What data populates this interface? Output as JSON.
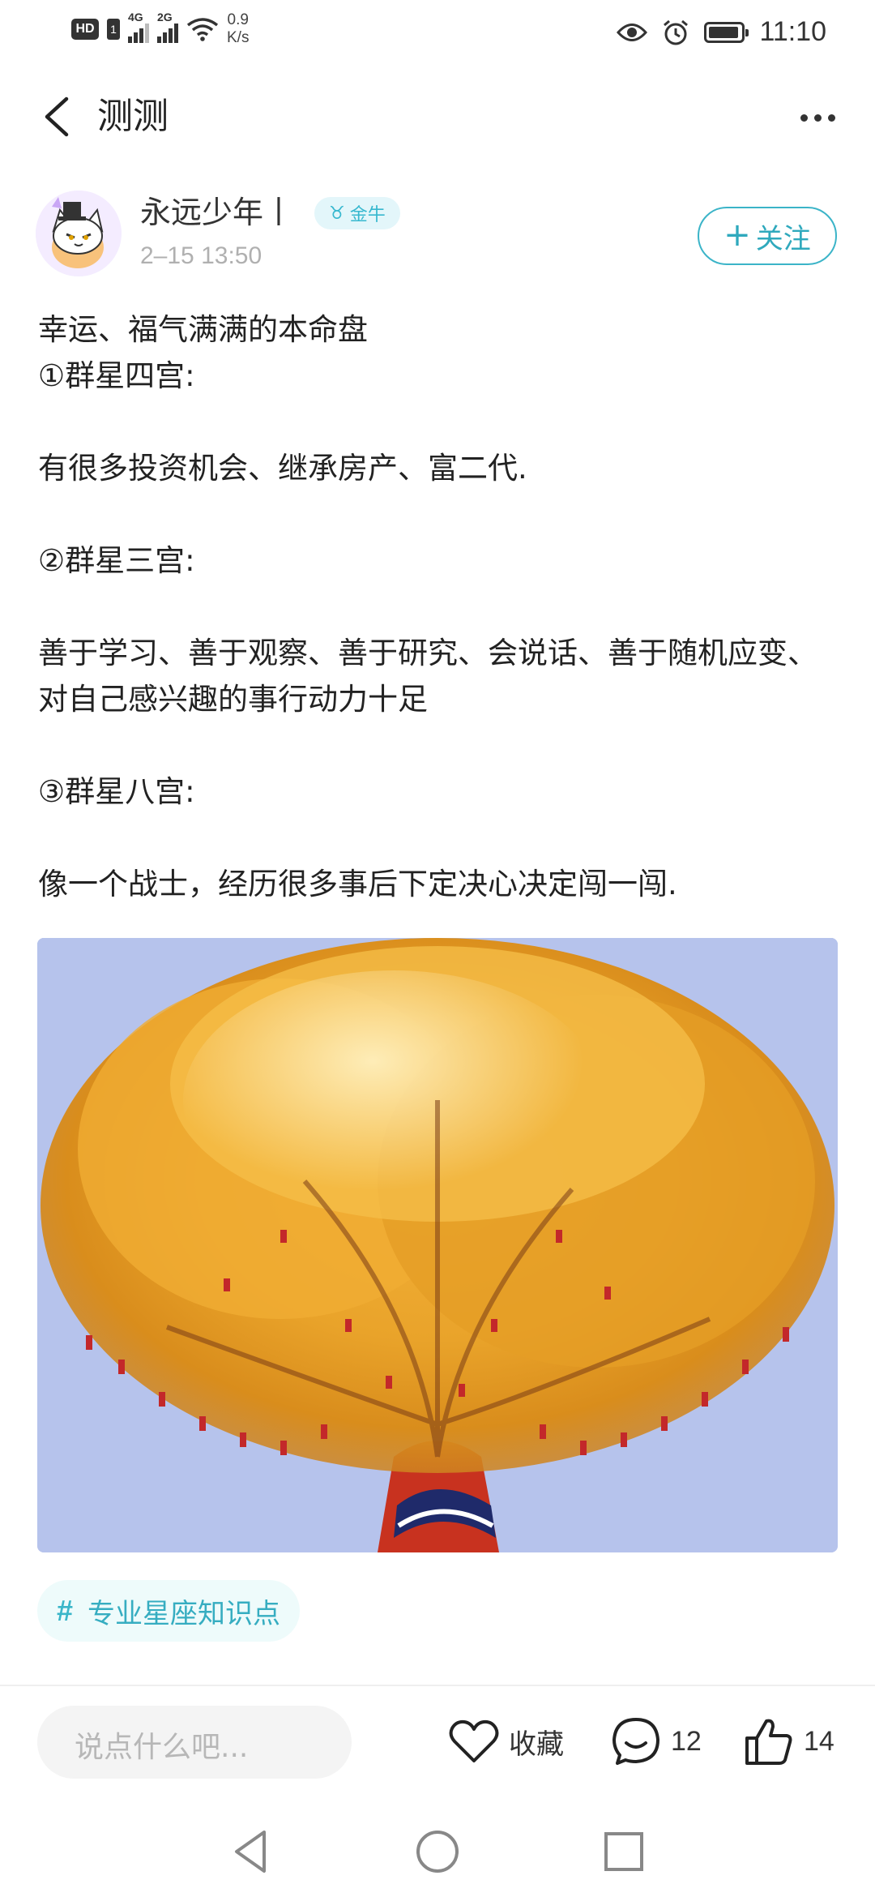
{
  "status_bar": {
    "network_1": "4G",
    "network_2": "2G",
    "speed_value": "0.9",
    "speed_unit": "K/s",
    "time": "11:10"
  },
  "header": {
    "title": "测测"
  },
  "post": {
    "author": {
      "name": "永远少年丨",
      "zodiac_symbol": "♉",
      "zodiac": "金牛",
      "time": "2–15 13:50"
    },
    "follow_label": "关注",
    "lines": {
      "l1": "幸运、福气满满的本命盘",
      "l2": "①群星四宫:",
      "l3": "有很多投资机会、继承房产、富二代.",
      "l4": "②群星三宫:",
      "l5": "善于学习、善于观察、善于研究、会说话、善于随机应变、对自己感兴趣的事行动力十足",
      "l6": "③群星八宫:",
      "l7": "像一个战士，经历很多事后下定决心决定闯一闯."
    },
    "topic": "专业星座知识点"
  },
  "bottom_bar": {
    "comment_placeholder": "说点什么吧...",
    "favorite_label": "收藏",
    "comment_count": "12",
    "like_count": "14"
  },
  "colors": {
    "accent": "#3bb4c8",
    "tag_bg": "#eefbfb"
  }
}
